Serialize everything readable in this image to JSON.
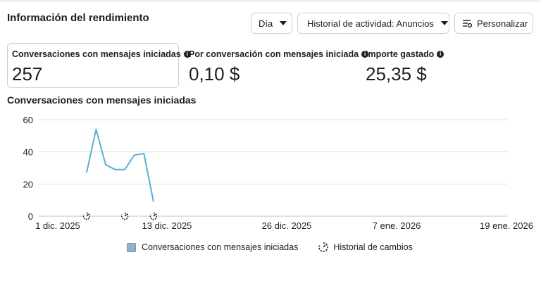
{
  "header": {
    "title": "Información del rendimiento",
    "day_label": "Día",
    "history_label": "Historial de actividad: Anuncios",
    "customize_label": "Personalizar"
  },
  "metrics": [
    {
      "label": "Conversaciones con mensajes iniciadas",
      "value": "257"
    },
    {
      "label": "Por conversación con mensajes iniciada",
      "value": "0,10 $"
    },
    {
      "label": "Importe gastado",
      "value": "25,35 $"
    }
  ],
  "chart_title": "Conversaciones con mensajes iniciadas",
  "legend": {
    "series_label": "Conversaciones con mensajes iniciadas",
    "changes_label": "Historial de cambios"
  },
  "colors": {
    "line": "#5aaed6",
    "swatch": "#8fb3cf",
    "grid": "#dddfe2"
  },
  "chart_data": {
    "type": "line",
    "series": [
      {
        "name": "Conversaciones con mensajes iniciadas",
        "x": [
          "2025-12-06",
          "2025-12-07",
          "2025-12-08",
          "2025-12-09",
          "2025-12-10",
          "2025-12-11",
          "2025-12-12",
          "2025-12-13"
        ],
        "y": [
          27,
          54,
          32,
          29,
          29,
          38,
          39,
          9
        ]
      }
    ],
    "change_markers": [
      "2025-12-06",
      "2025-12-10",
      "2025-12-13"
    ],
    "x_tick_labels": [
      "1 dic. 2025",
      "13 dic. 2025",
      "26 dic. 2025",
      "7 ene. 2026",
      "19 ene. 2026"
    ],
    "y_ticks": [
      0,
      20,
      40,
      60
    ],
    "ylim": [
      0,
      60
    ],
    "xlim": [
      "2025-12-01",
      "2026-01-19"
    ],
    "grid": true,
    "legend_position": "bottom"
  }
}
